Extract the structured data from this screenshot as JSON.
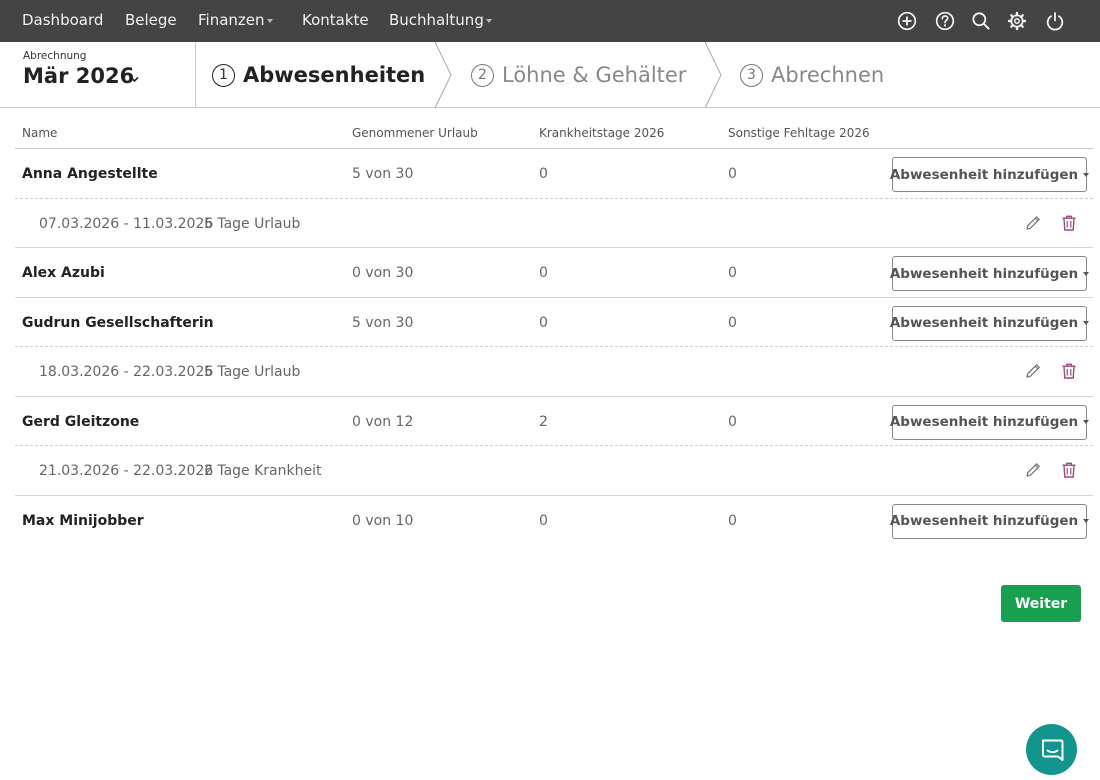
{
  "nav": {
    "items": [
      {
        "label": "Dashboard",
        "has_caret": false
      },
      {
        "label": "Belege",
        "has_caret": false
      },
      {
        "label": "Finanzen",
        "has_caret": true
      },
      {
        "label": "Kontakte",
        "has_caret": false
      },
      {
        "label": "Buchhaltung",
        "has_caret": true
      }
    ],
    "icons": [
      "plus-circle-icon",
      "help-icon",
      "search-icon",
      "gear-icon",
      "power-icon"
    ]
  },
  "period": {
    "label": "Abrechnung",
    "value": "Mär 2026"
  },
  "steps": [
    {
      "number": "1",
      "label": "Abwesenheiten",
      "active": true
    },
    {
      "number": "2",
      "label": "Löhne & Gehälter",
      "active": false
    },
    {
      "number": "3",
      "label": "Abrechnen",
      "active": false
    }
  ],
  "table": {
    "columns": [
      "Name",
      "Genommener Urlaub",
      "Krankheitstage 2026",
      "Sonstige Fehltage 2026"
    ],
    "add_button_label": "Abwesenheit hinzufügen",
    "employees": [
      {
        "name": "Anna Angestellte",
        "vacation": "5 von 30",
        "sick_days": "0",
        "other_days": "0",
        "absences": [
          {
            "period": "07.03.2026 - 11.03.2026",
            "description": "5 Tage Urlaub"
          }
        ]
      },
      {
        "name": "Alex Azubi",
        "vacation": "0 von 30",
        "sick_days": "0",
        "other_days": "0",
        "absences": []
      },
      {
        "name": "Gudrun Gesellschafterin",
        "vacation": "5 von 30",
        "sick_days": "0",
        "other_days": "0",
        "absences": [
          {
            "period": "18.03.2026 - 22.03.2026",
            "description": "5 Tage Urlaub"
          }
        ]
      },
      {
        "name": "Gerd Gleitzone",
        "vacation": "0 von 12",
        "sick_days": "2",
        "other_days": "0",
        "absences": [
          {
            "period": "21.03.2026 - 22.03.2026",
            "description": "2 Tage Krankheit"
          }
        ]
      },
      {
        "name": "Max Minijobber",
        "vacation": "0 von 10",
        "sick_days": "0",
        "other_days": "0",
        "absences": []
      }
    ]
  },
  "actions": {
    "next_label": "Weiter"
  },
  "colors": {
    "nav_bg": "#444444",
    "primary_green": "#17a050",
    "chat_teal": "#12948f",
    "trash_purple": "#9b4a7c"
  }
}
